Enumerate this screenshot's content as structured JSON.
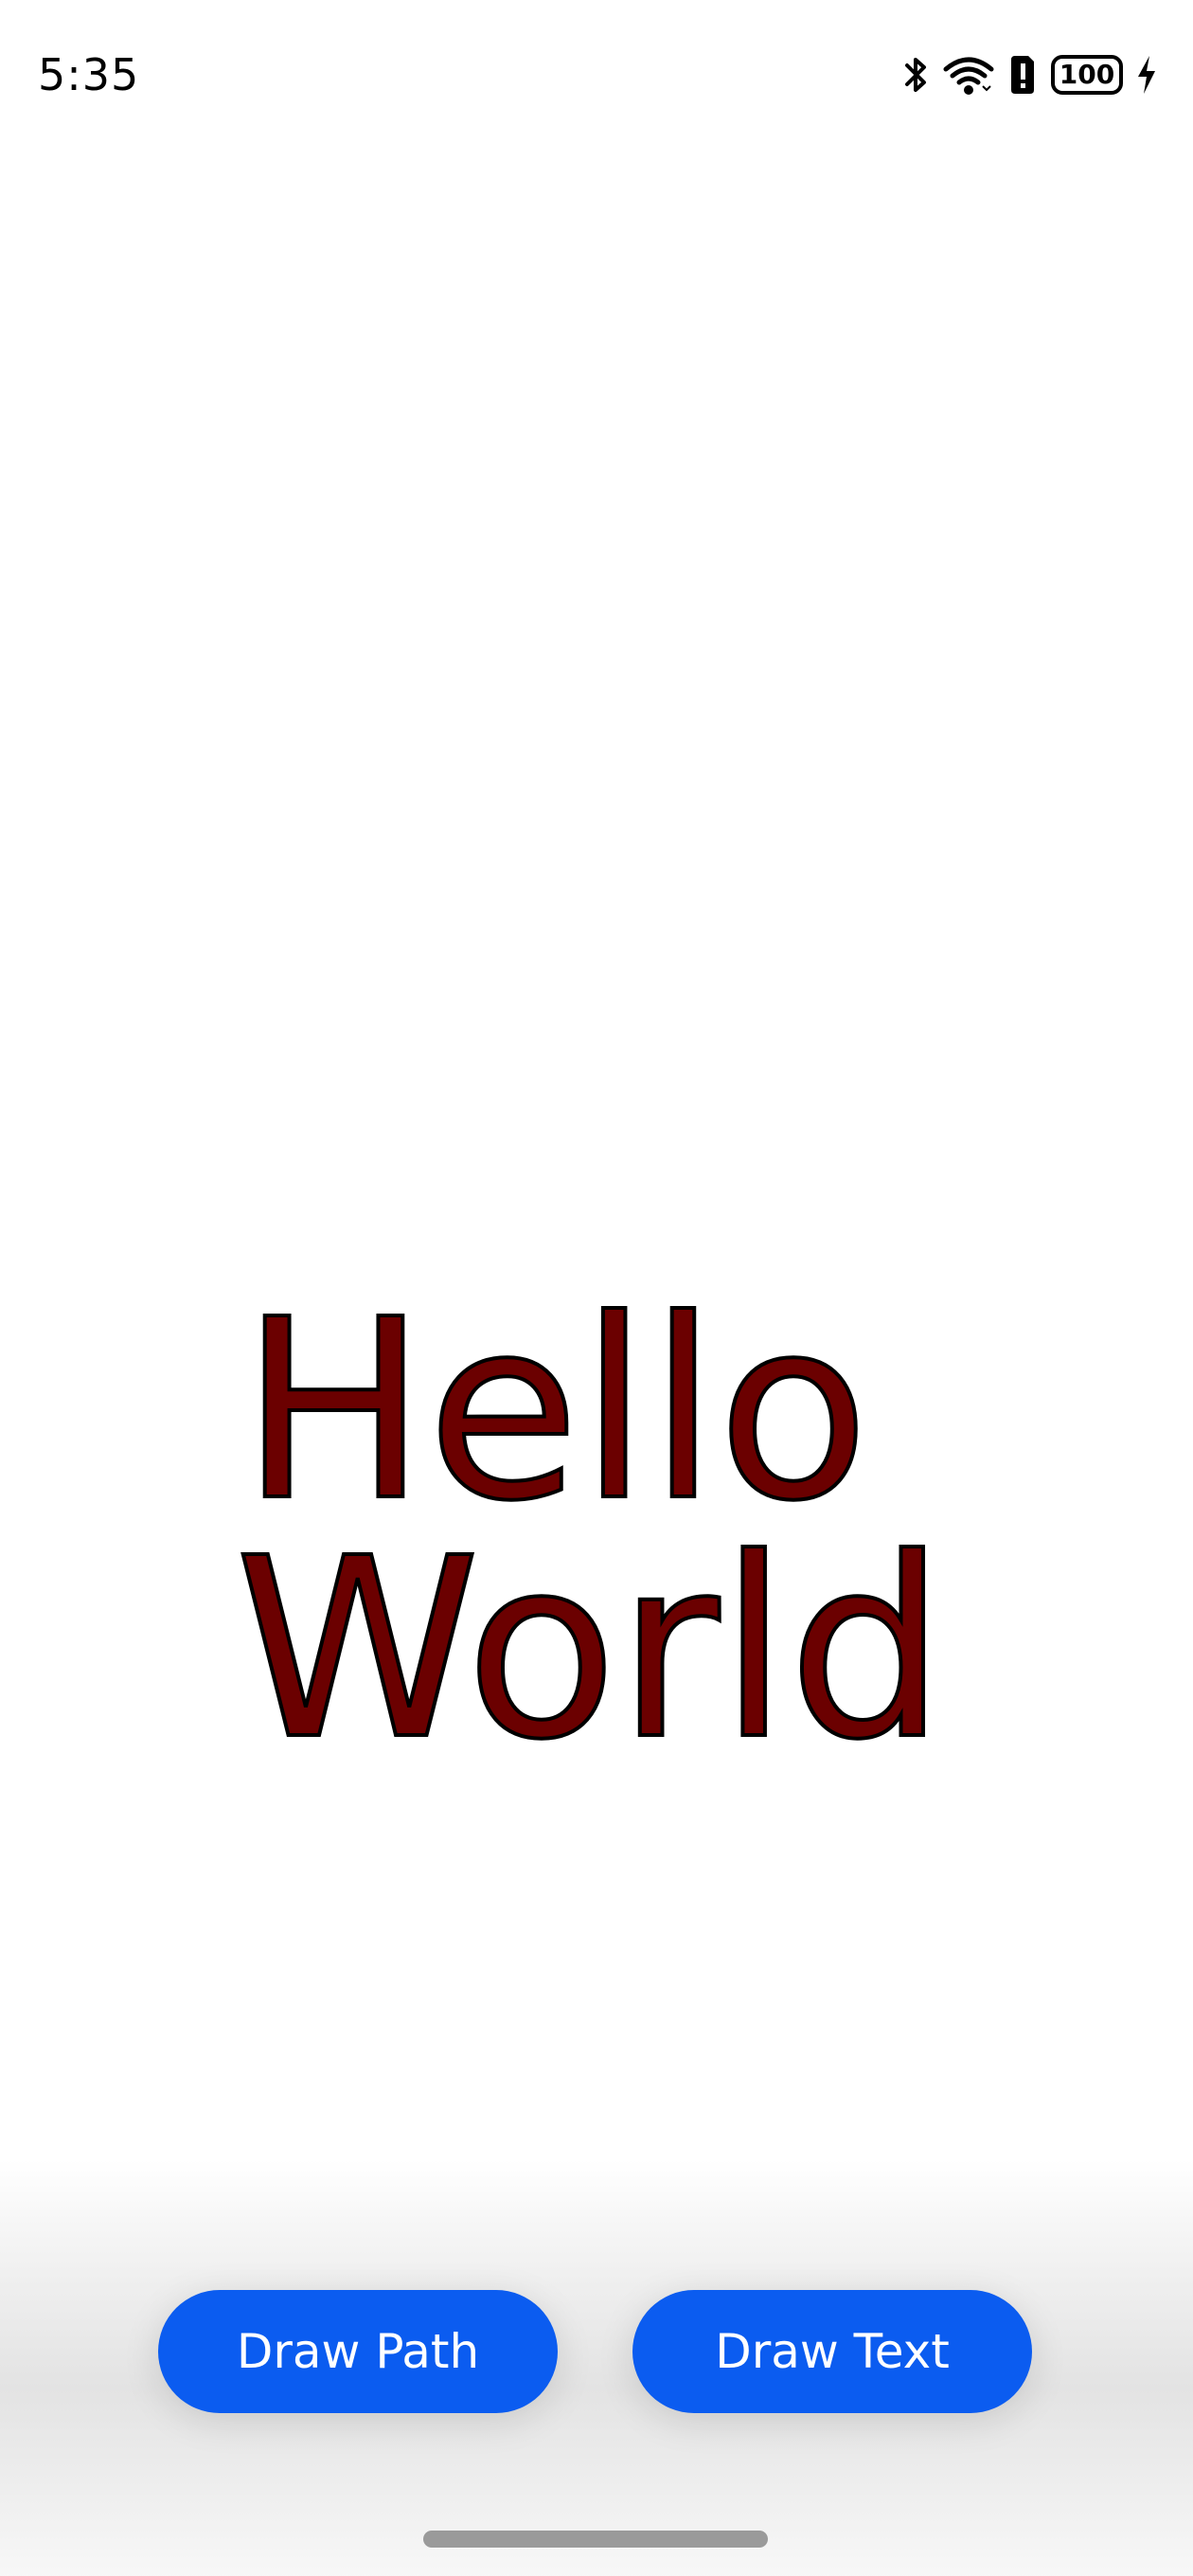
{
  "status_bar": {
    "time": "5:35",
    "battery_level": "100",
    "icons": [
      "bluetooth-icon",
      "wifi-icon",
      "sim-alert-icon",
      "battery-icon",
      "charging-icon"
    ]
  },
  "canvas": {
    "line1": "Hello",
    "line2": "World",
    "text_fill_color": "#6b0000",
    "text_stroke_color": "#000000"
  },
  "buttons": {
    "draw_path_label": "Draw Path",
    "draw_text_label": "Draw Text",
    "accent_color": "#0b5cf0"
  }
}
